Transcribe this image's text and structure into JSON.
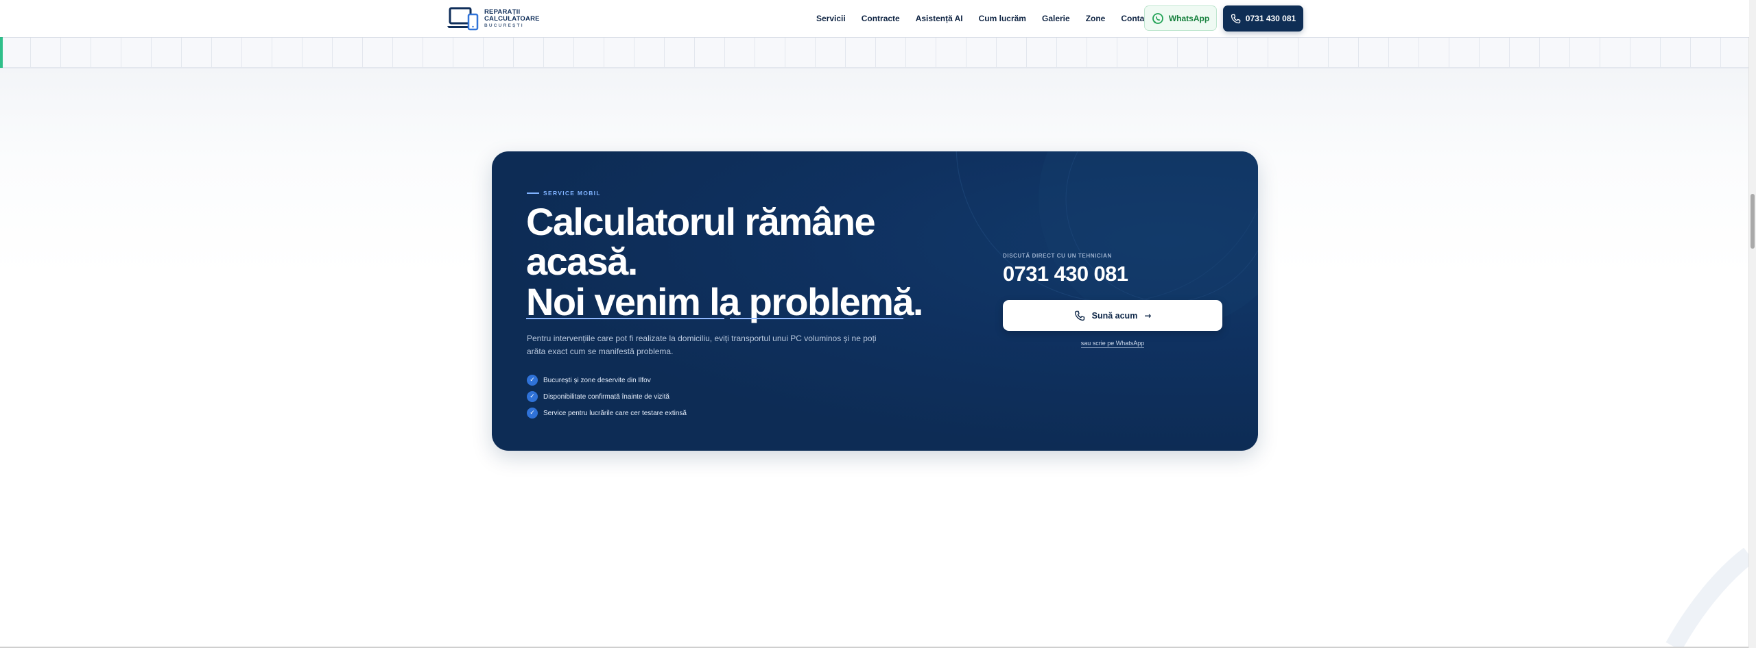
{
  "brand": {
    "line1": "REPARAȚII",
    "line2": "CALCULATOARE",
    "line3": "BUCUREȘTI"
  },
  "nav": {
    "items": [
      "Servicii",
      "Contracte",
      "Asistență AI",
      "Cum lucrăm",
      "Galerie",
      "Zone",
      "Contact"
    ]
  },
  "header": {
    "whatsapp_label": "WhatsApp",
    "phone_label": "0731 430 081"
  },
  "cta": {
    "eyebrow": "SERVICE MOBIL",
    "heading_line1": "Calculatorul rămâne",
    "heading_line2": "acasă.",
    "heading_line3": "Noi venim la problemă.",
    "lead": "Pentru intervențiile care pot fi realizate la domiciliu, eviți transportul unui PC voluminos și ne poți arăta exact cum se manifestă problema.",
    "checks": [
      "București și zone deservite din Ilfov",
      "Disponibilitate confirmată înainte de vizită",
      "Service pentru lucrările care cer testare extinsă"
    ],
    "talk_label": "DISCUTĂ DIRECT CU UN TEHNICIAN",
    "phone": "0731 430 081",
    "call_now_label": "Sună acum",
    "call_arrow": "→",
    "whatsapp_link": "sau scrie pe WhatsApp"
  },
  "colors": {
    "card_bg": "#0f3160",
    "accent_blue": "#2f72d8",
    "accent_green": "#2fbf8a",
    "whatsapp_green": "#16803d"
  }
}
